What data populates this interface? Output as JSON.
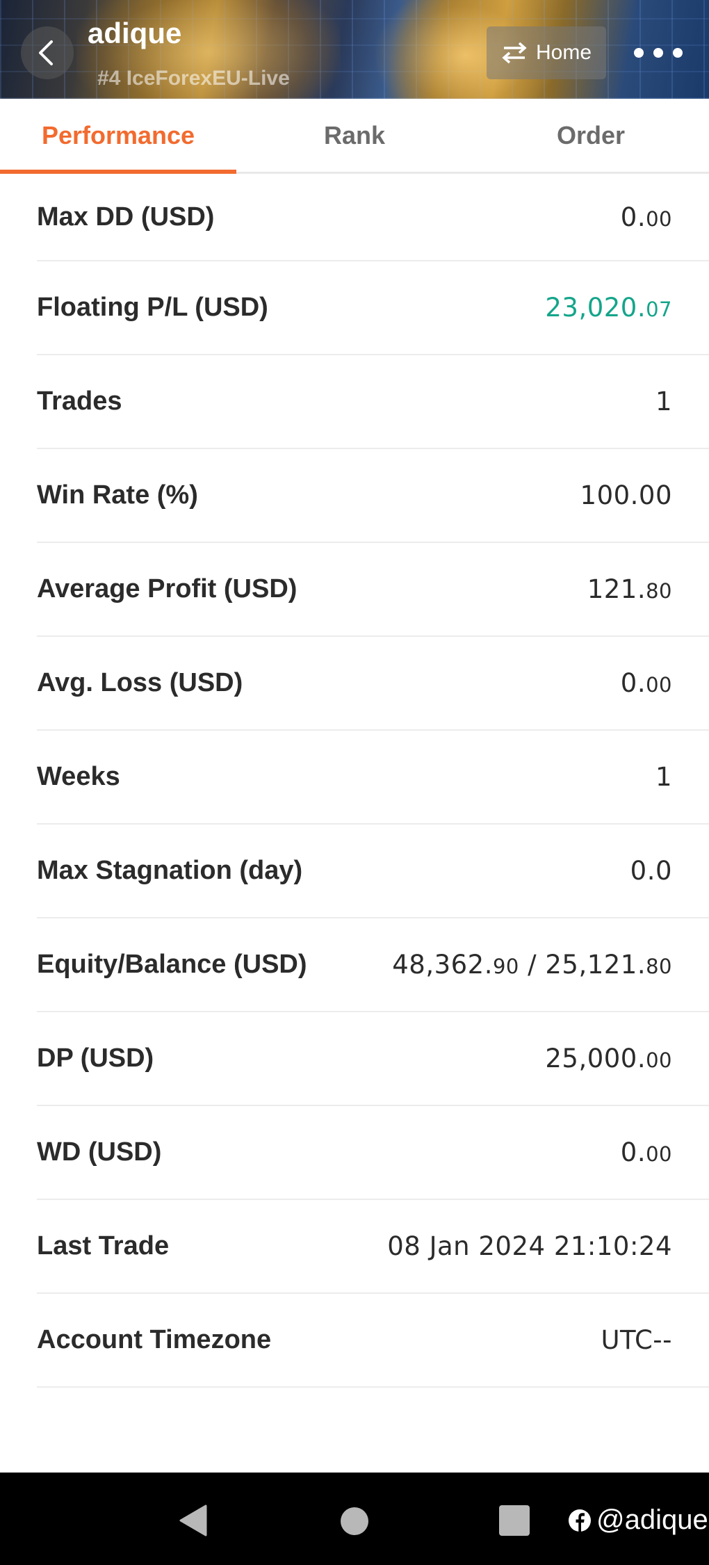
{
  "header": {
    "title": "adique",
    "subtitle": "#4  IceForexEU-Live",
    "home_label": "Home",
    "back_icon": "chevron-left-icon",
    "switch_icon": "swap-arrows-icon",
    "more_icon": "more-dots-icon"
  },
  "tabs": [
    {
      "label": "Performance",
      "active": true
    },
    {
      "label": "Rank",
      "active": false
    },
    {
      "label": "Order",
      "active": false
    }
  ],
  "accent_color": "#f26b2f",
  "positive_color": "#14a58a",
  "stats": [
    {
      "label": "Max DD (USD)",
      "int": "0.",
      "dec": "00"
    },
    {
      "label": "Floating P/L (USD)",
      "int": "23,020.",
      "dec": "07",
      "positive": true
    },
    {
      "label": "Trades",
      "int": "1",
      "dec": ""
    },
    {
      "label": "Win Rate (%)",
      "int": "100.00",
      "dec": ""
    },
    {
      "label": "Average Profit (USD)",
      "int": "121.",
      "dec": "80"
    },
    {
      "label": "Avg. Loss (USD)",
      "int": "0.",
      "dec": "00"
    },
    {
      "label": "Weeks",
      "int": "1",
      "dec": ""
    },
    {
      "label": "Max Stagnation (day)",
      "int": "0.0",
      "dec": ""
    },
    {
      "label": "Equity/Balance (USD)",
      "int": "48,362.",
      "dec": "90",
      "int2": " / 25,121.",
      "dec2": "80"
    },
    {
      "label": "DP (USD)",
      "int": "25,000.",
      "dec": "00"
    },
    {
      "label": "WD (USD)",
      "int": "0.",
      "dec": "00"
    },
    {
      "label": "Last Trade",
      "int": "08 Jan 2024 21:10:24",
      "dec": ""
    },
    {
      "label": "Account Timezone",
      "int": "UTC--",
      "dec": ""
    }
  ],
  "navbar": {
    "back_icon": "nav-back-triangle-icon",
    "home_icon": "nav-home-circle-icon",
    "recent_icon": "nav-recents-square-icon",
    "watermark": "@adique",
    "watermark_icon": "facebook-icon"
  }
}
